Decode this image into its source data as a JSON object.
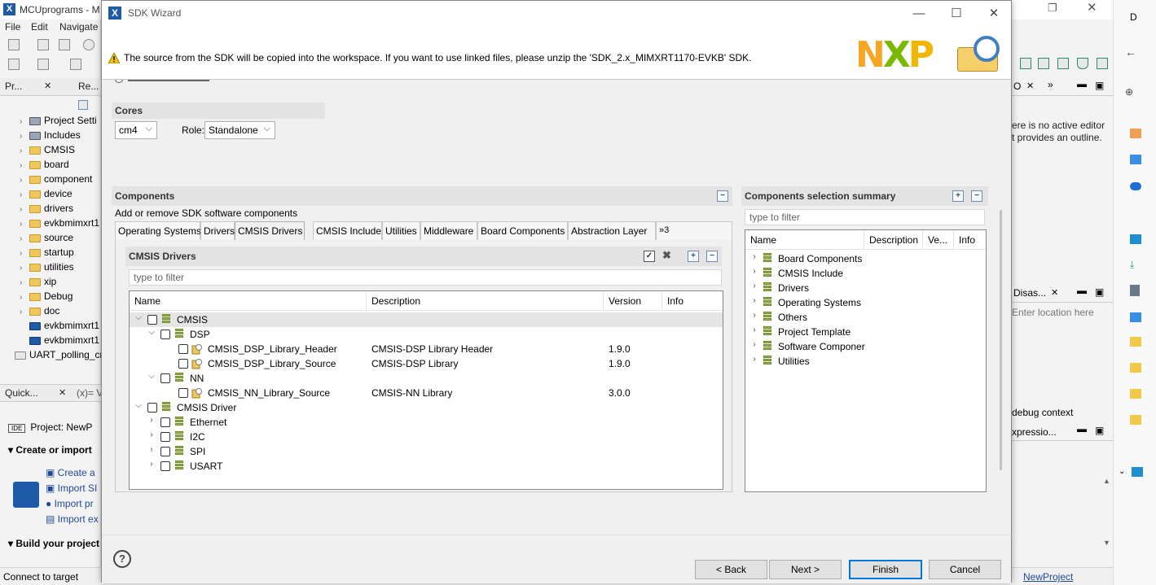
{
  "ide": {
    "title": "MCUprograms - M",
    "menu": [
      "File",
      "Edit",
      "Navigate"
    ],
    "view_tabs": [
      "Pr...",
      "Re..."
    ],
    "project_tree": [
      {
        "label": "Project Setti",
        "icon": "settings-icon"
      },
      {
        "label": "Includes",
        "icon": "includes-icon"
      },
      {
        "label": "CMSIS",
        "icon": "folder-icon"
      },
      {
        "label": "board",
        "icon": "folder-icon"
      },
      {
        "label": "component",
        "icon": "folder-icon"
      },
      {
        "label": "device",
        "icon": "folder-icon"
      },
      {
        "label": "drivers",
        "icon": "folder-icon"
      },
      {
        "label": "evkbmimxrt1",
        "icon": "folder-icon"
      },
      {
        "label": "source",
        "icon": "folder-icon"
      },
      {
        "label": "startup",
        "icon": "folder-icon"
      },
      {
        "label": "utilities",
        "icon": "folder-icon"
      },
      {
        "label": "xip",
        "icon": "folder-icon"
      },
      {
        "label": "Debug",
        "icon": "folder-icon"
      },
      {
        "label": "doc",
        "icon": "folder-icon"
      },
      {
        "label": "evkbmimxrt1",
        "icon": "x-file-icon"
      },
      {
        "label": "evkbmimxrt1",
        "icon": "ls-file-icon"
      },
      {
        "label": "UART_polling_cr",
        "icon": "project-icon"
      }
    ],
    "quickstart_tabs": [
      "Quick...",
      "(x)= Va"
    ],
    "quickstart": {
      "project": "Project: NewP",
      "create_or_import": "Create or import",
      "links": [
        "Create a",
        "Import SI",
        "Import pr",
        "Import ex"
      ],
      "build": "Build your project"
    },
    "status": "Connect to target",
    "right_panel": {
      "outline_text_1": "ere is no active editor",
      "outline_text_2": "t provides an outline.",
      "disas_tab": "Disas...",
      "location_placeholder": "Enter location here",
      "debug_context": "debug context",
      "expressions_tab": "xpressio...",
      "status_link": "NewProject"
    }
  },
  "dialog": {
    "title": "SDK Wizard",
    "warning": "The source from the SDK will be copied into the workspace. If you want to use linked files, please unzip the 'SDK_2.x_MIMXRT1170-EVKB' SDK.",
    "logo_text": "NXP",
    "cores": {
      "header": "Cores",
      "core_value": "cm4",
      "role_label": "Role:",
      "role_value": "Standalone"
    },
    "components": {
      "header": "Components",
      "subtitle": "Add or remove SDK software components",
      "tabs": [
        "Operating Systems",
        "Drivers",
        "CMSIS Drivers",
        "CMSIS Include",
        "Utilities",
        "Middleware",
        "Board Components",
        "Abstraction Layer"
      ],
      "overflow_tabs": "»3",
      "active_tab": "CMSIS Drivers",
      "inner_header": "CMSIS Drivers",
      "filter_placeholder": "type to filter",
      "columns": [
        "Name",
        "Description",
        "Version",
        "Info"
      ],
      "rows": [
        {
          "name": "CMSIS",
          "desc": "",
          "version": "",
          "level": 0,
          "expanded": true,
          "type": "group"
        },
        {
          "name": "DSP",
          "desc": "",
          "version": "",
          "level": 1,
          "expanded": true,
          "type": "group"
        },
        {
          "name": "CMSIS_DSP_Library_Header",
          "desc": "CMSIS-DSP Library Header",
          "version": "1.9.0",
          "level": 2,
          "type": "item"
        },
        {
          "name": "CMSIS_DSP_Library_Source",
          "desc": "CMSIS-DSP Library",
          "version": "1.9.0",
          "level": 2,
          "type": "item"
        },
        {
          "name": "NN",
          "desc": "",
          "version": "",
          "level": 1,
          "expanded": true,
          "type": "group"
        },
        {
          "name": "CMSIS_NN_Library_Source",
          "desc": "CMSIS-NN Library",
          "version": "3.0.0",
          "level": 2,
          "type": "item"
        },
        {
          "name": "CMSIS Driver",
          "desc": "",
          "version": "",
          "level": 0,
          "expanded": true,
          "type": "group"
        },
        {
          "name": "Ethernet",
          "desc": "",
          "version": "",
          "level": 1,
          "expanded": false,
          "type": "group"
        },
        {
          "name": "I2C",
          "desc": "",
          "version": "",
          "level": 1,
          "expanded": false,
          "type": "group"
        },
        {
          "name": "SPI",
          "desc": "",
          "version": "",
          "level": 1,
          "expanded": false,
          "type": "group"
        },
        {
          "name": "USART",
          "desc": "",
          "version": "",
          "level": 1,
          "expanded": false,
          "type": "group"
        }
      ]
    },
    "summary": {
      "header": "Components selection summary",
      "filter_placeholder": "type to filter",
      "columns": [
        "Name",
        "Description",
        "Ve...",
        "Info"
      ],
      "items": [
        "Board Components",
        "CMSIS Include",
        "Drivers",
        "Operating Systems",
        "Others",
        "Project Template",
        "Software Componer",
        "Utilities"
      ]
    },
    "buttons": {
      "help": "?",
      "back": "< Back",
      "next": "Next >",
      "finish": "Finish",
      "cancel": "Cancel"
    }
  },
  "colors": {
    "accent": "#0078d7",
    "nxp_n": "#f5a623",
    "nxp_x": "#7bb800",
    "nxp_p": "#f2b600",
    "warning": "#f5c400"
  }
}
